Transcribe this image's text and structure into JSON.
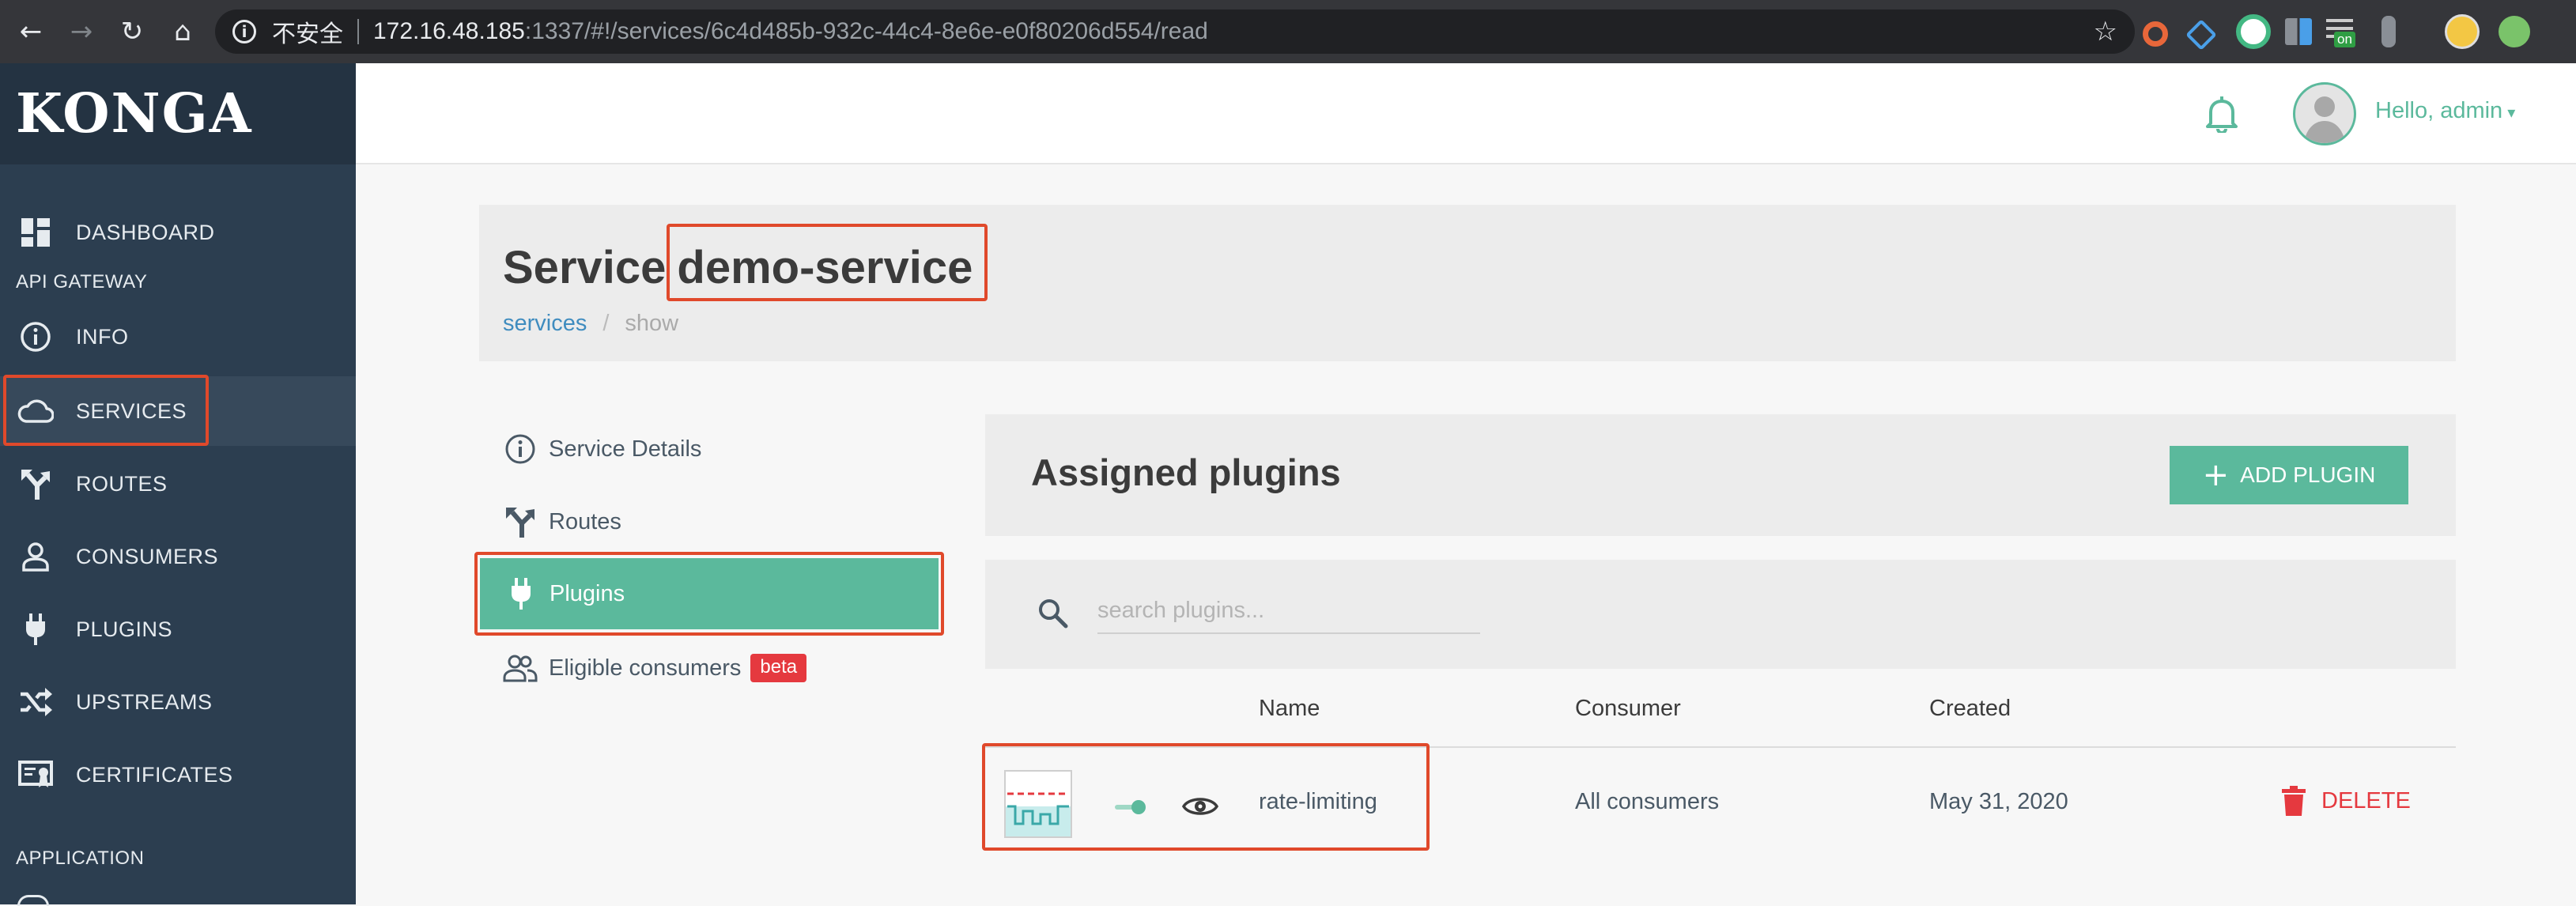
{
  "browser": {
    "insecure_label": "不安全",
    "url_host": "172.16.48.185",
    "url_path": ":1337/#!/services/6c4d485b-932c-44c4-8e6e-e0f80206d554/read",
    "extension_badge": "on"
  },
  "sidebar": {
    "brand": "KONGA",
    "items": [
      {
        "label": "DASHBOARD"
      },
      {
        "label": "INFO"
      },
      {
        "label": "SERVICES"
      },
      {
        "label": "ROUTES"
      },
      {
        "label": "CONSUMERS"
      },
      {
        "label": "PLUGINS"
      },
      {
        "label": "UPSTREAMS"
      },
      {
        "label": "CERTIFICATES"
      }
    ],
    "sections": [
      "API GATEWAY",
      "APPLICATION"
    ]
  },
  "header": {
    "greeting": "Hello, admin"
  },
  "page": {
    "title_prefix": "Service",
    "service_name": "demo-service",
    "breadcrumb": {
      "link": "services",
      "separator": "/",
      "current": "show"
    }
  },
  "subnav": {
    "items": [
      {
        "label": "Service Details"
      },
      {
        "label": "Routes"
      },
      {
        "label": "Plugins"
      },
      {
        "label": "Eligible consumers"
      }
    ],
    "beta_badge": "beta"
  },
  "plugins": {
    "title": "Assigned plugins",
    "add_button": "ADD PLUGIN",
    "search_placeholder": "search plugins...",
    "columns": [
      "Name",
      "Consumer",
      "Created"
    ],
    "rows": [
      {
        "name": "rate-limiting",
        "consumer": "All consumers",
        "created": "May 31, 2020",
        "action": "DELETE"
      }
    ]
  },
  "colors": {
    "accent": "#5bb99c",
    "sidebar": "#2c3e50",
    "danger": "#e5393f",
    "highlight": "#e0492b"
  }
}
